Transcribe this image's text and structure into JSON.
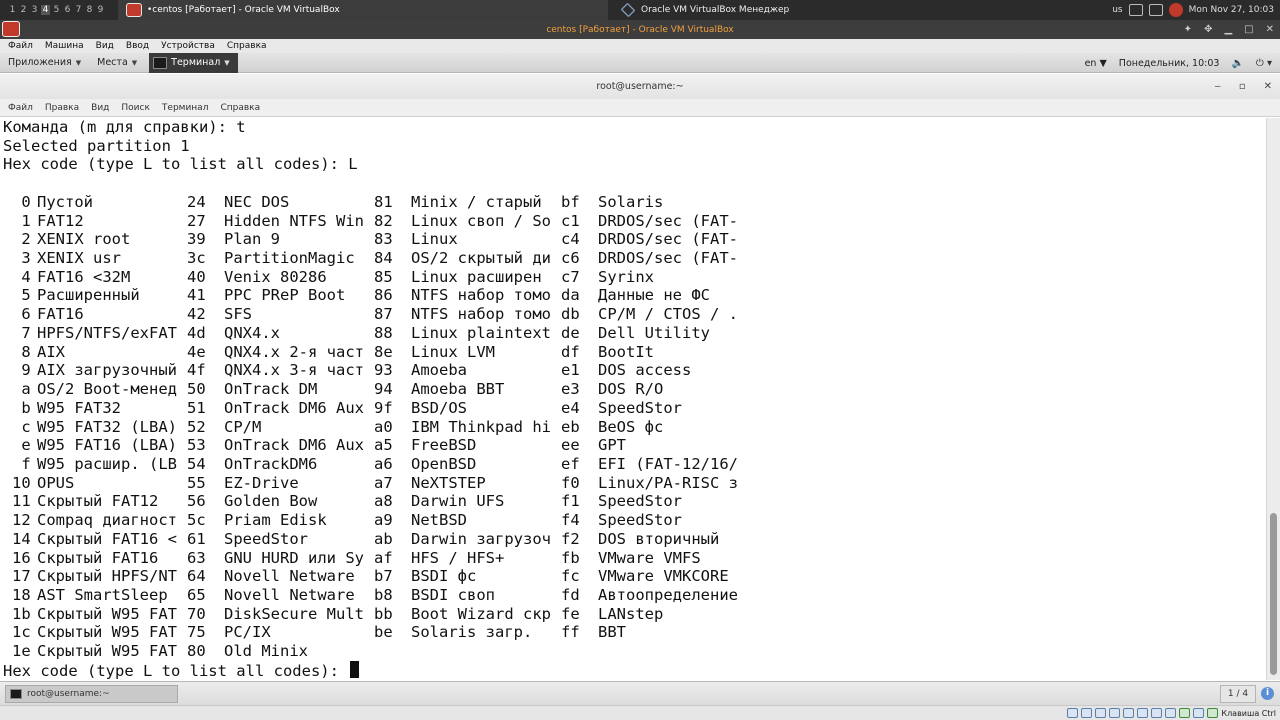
{
  "host_panel": {
    "workspaces": [
      "1",
      "2",
      "3",
      "4",
      "5",
      "6",
      "7",
      "8",
      "9"
    ],
    "active_workspace": "4",
    "task1": "•centos [Работает] - Oracle VM VirtualBox",
    "task2": "Oracle VM VirtualBox Менеджер",
    "kbd_layout": "us",
    "datetime": "Mon Nov 27, 10:03"
  },
  "vbox_window": {
    "title": "centos [Работает] - Oracle VM VirtualBox",
    "menu": [
      "Файл",
      "Машина",
      "Вид",
      "Ввод",
      "Устройства",
      "Справка"
    ],
    "status_keyboard": "Клавиша Ctrl"
  },
  "gnome": {
    "applications": "Приложения",
    "places": "Места",
    "terminal": "Терминал",
    "lang": "en",
    "clock": "Понедельник, 10:03"
  },
  "terminal": {
    "title": "root@username:~",
    "menu": [
      "Файл",
      "Правка",
      "Вид",
      "Поиск",
      "Терминал",
      "Справка"
    ],
    "header_lines": [
      "Команда (m для справки): t",
      "Selected partition 1",
      "Hex code (type L to list all codes): L",
      ""
    ],
    "table": [
      [
        " 0",
        "Пустой",
        "24",
        "NEC DOS",
        "81",
        "Minix / старый",
        "bf",
        "Solaris"
      ],
      [
        " 1",
        "FAT12",
        "27",
        "Hidden NTFS Win",
        "82",
        "Linux своп / So",
        "c1",
        "DRDOS/sec (FAT-"
      ],
      [
        " 2",
        "XENIX root",
        "39",
        "Plan 9",
        "83",
        "Linux",
        "c4",
        "DRDOS/sec (FAT-"
      ],
      [
        " 3",
        "XENIX usr",
        "3c",
        "PartitionMagic",
        "84",
        "OS/2 скрытый ди",
        "c6",
        "DRDOS/sec (FAT-"
      ],
      [
        " 4",
        "FAT16 <32M",
        "40",
        "Venix 80286",
        "85",
        "Linux расширен",
        "c7",
        "Syrinx"
      ],
      [
        " 5",
        "Расширенный",
        "41",
        "PPC PReP Boot",
        "86",
        "NTFS набор томо",
        "da",
        "Данные не ФС"
      ],
      [
        " 6",
        "FAT16",
        "42",
        "SFS",
        "87",
        "NTFS набор томо",
        "db",
        "CP/M / CTOS / ."
      ],
      [
        " 7",
        "HPFS/NTFS/exFAT",
        "4d",
        "QNX4.x",
        "88",
        "Linux plaintext",
        "de",
        "Dell Utility"
      ],
      [
        " 8",
        "AIX",
        "4e",
        "QNX4.x 2-я част",
        "8e",
        "Linux LVM",
        "df",
        "BootIt"
      ],
      [
        " 9",
        "AIX загрузочный",
        "4f",
        "QNX4.x 3-я част",
        "93",
        "Amoeba",
        "e1",
        "DOS access"
      ],
      [
        " a",
        "OS/2 Boot-менед",
        "50",
        "OnTrack DM",
        "94",
        "Amoeba BBT",
        "e3",
        "DOS R/O"
      ],
      [
        " b",
        "W95 FAT32",
        "51",
        "OnTrack DM6 Aux",
        "9f",
        "BSD/OS",
        "e4",
        "SpeedStor"
      ],
      [
        " c",
        "W95 FAT32 (LBA)",
        "52",
        "CP/M",
        "a0",
        "IBM Thinkpad hi",
        "eb",
        "BeOS фс"
      ],
      [
        " e",
        "W95 FAT16 (LBA)",
        "53",
        "OnTrack DM6 Aux",
        "a5",
        "FreeBSD",
        "ee",
        "GPT"
      ],
      [
        " f",
        "W95 расшир. (LB",
        "54",
        "OnTrackDM6",
        "a6",
        "OpenBSD",
        "ef",
        "EFI (FAT-12/16/"
      ],
      [
        "10",
        "OPUS",
        "55",
        "EZ-Drive",
        "a7",
        "NeXTSTEP",
        "f0",
        "Linux/PA-RISC з"
      ],
      [
        "11",
        "Скрытый FAT12",
        "56",
        "Golden Bow",
        "a8",
        "Darwin UFS",
        "f1",
        "SpeedStor"
      ],
      [
        "12",
        "Compaq диагност",
        "5c",
        "Priam Edisk",
        "a9",
        "NetBSD",
        "f4",
        "SpeedStor"
      ],
      [
        "14",
        "Скрытый FAT16 <",
        "61",
        "SpeedStor",
        "ab",
        "Darwin загрузоч",
        "f2",
        "DOS вторичный"
      ],
      [
        "16",
        "Скрытый FAT16",
        "63",
        "GNU HURD или Sy",
        "af",
        "HFS / HFS+",
        "fb",
        "VMware VMFS"
      ],
      [
        "17",
        "Скрытый HPFS/NT",
        "64",
        "Novell Netware",
        "b7",
        "BSDI фс",
        "fc",
        "VMware VMKCORE"
      ],
      [
        "18",
        "AST SmartSleep",
        "65",
        "Novell Netware",
        "b8",
        "BSDI своп",
        "fd",
        "Автоопределение"
      ],
      [
        "1b",
        "Скрытый W95 FAT",
        "70",
        "DiskSecure Mult",
        "bb",
        "Boot Wizard скр",
        "fe",
        "LANstep"
      ],
      [
        "1c",
        "Скрытый W95 FAT",
        "75",
        "PC/IX",
        "be",
        "Solaris загр.",
        "ff",
        "BBT"
      ],
      [
        "1e",
        "Скрытый W95 FAT",
        "80",
        "Old Minix",
        "",
        "",
        "",
        ""
      ]
    ],
    "prompt": "Hex code (type L to list all codes): "
  },
  "guest_bottom": {
    "task": "root@username:~",
    "workspace": "1 / 4"
  }
}
